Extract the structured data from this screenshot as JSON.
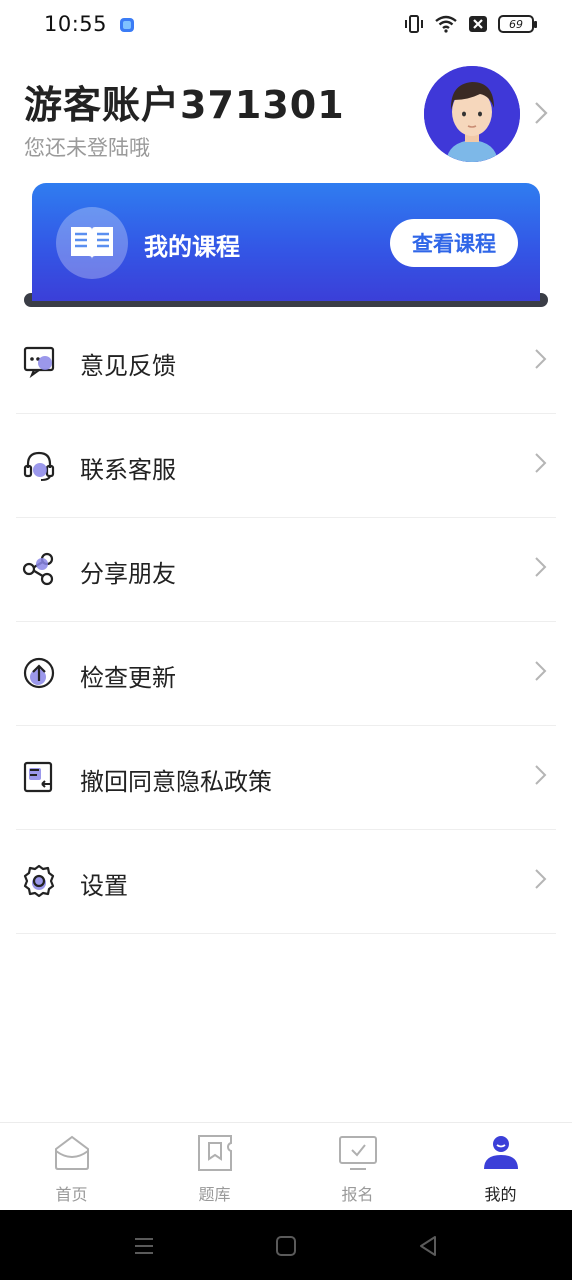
{
  "status_bar": {
    "time": "10:55",
    "battery": "69",
    "icons": [
      "vibrate-icon",
      "wifi-icon",
      "sim-off-icon",
      "battery-icon"
    ]
  },
  "profile": {
    "username": "游客账户371301",
    "login_hint": "您还未登陆哦",
    "avatar_icon": "avatar-icon"
  },
  "course_card": {
    "title": "我的课程",
    "button_label": "查看课程",
    "icon": "book-icon"
  },
  "menu": {
    "items": [
      {
        "label": "意见反馈",
        "icon": "feedback-icon"
      },
      {
        "label": "联系客服",
        "icon": "headset-icon"
      },
      {
        "label": "分享朋友",
        "icon": "share-icon"
      },
      {
        "label": "检查更新",
        "icon": "update-icon"
      },
      {
        "label": "撤回同意隐私政策",
        "icon": "privacy-revoke-icon"
      },
      {
        "label": "设置",
        "icon": "settings-icon"
      }
    ]
  },
  "tabbar": {
    "tabs": [
      {
        "label": "首页",
        "icon": "home-icon",
        "active": false
      },
      {
        "label": "题库",
        "icon": "question-bank-icon",
        "active": false
      },
      {
        "label": "报名",
        "icon": "signup-icon",
        "active": false
      },
      {
        "label": "我的",
        "icon": "profile-icon",
        "active": true
      }
    ]
  },
  "colors": {
    "accent": "#3b3fd8",
    "card_gradient_top": "#2f7df0",
    "card_gradient_bottom": "#3b3fd8",
    "button_text": "#2f66e8",
    "icon_purple": "#8a86e8"
  }
}
